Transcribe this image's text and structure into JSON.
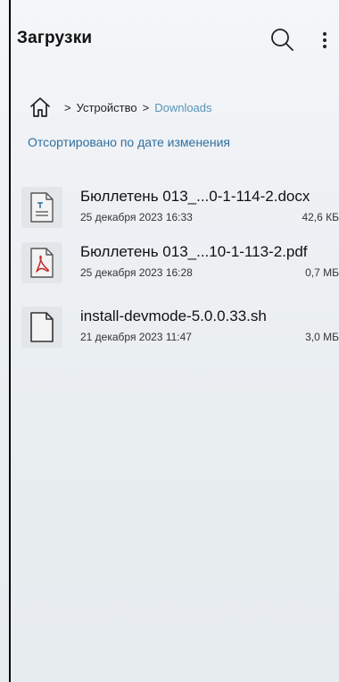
{
  "header": {
    "title": "Загрузки"
  },
  "breadcrumb": {
    "items": [
      {
        "label": "Устройство"
      },
      {
        "label": "Downloads"
      }
    ]
  },
  "sort": {
    "label": "Отсортировано по дате изменения"
  },
  "files": [
    {
      "name": "Бюллетень 013_...0-1-114-2.docx",
      "date": "25 декабря 2023 16:33",
      "size": "42,6 КБ",
      "icon": "docx-file-icon"
    },
    {
      "name": "Бюллетень 013_...10-1-113-2.pdf",
      "date": "25 декабря 2023 16:28",
      "size": "0,7 МБ",
      "icon": "pdf-file-icon"
    },
    {
      "name": "install-devmode-5.0.0.33.sh",
      "date": "21 декабря 2023 11:47",
      "size": "3,0 МБ",
      "icon": "generic-file-icon"
    }
  ],
  "colors": {
    "link": "#2e6f9e",
    "breadcrumb_current": "#5a93b8",
    "pdf_red": "#c62828"
  }
}
